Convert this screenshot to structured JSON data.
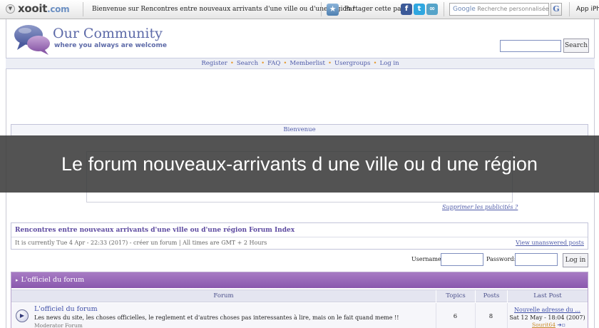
{
  "toolbar": {
    "logo_main": "xooit",
    "logo_ext": ".com",
    "welcome": "Bienvenue sur Rencontres entre nouveaux arrivants d'une ville ou d'une région !",
    "share_label": "Partager cette page",
    "social": [
      {
        "name": "facebook",
        "glyph": "f",
        "color": "#3b5998"
      },
      {
        "name": "twitter",
        "glyph": "t",
        "color": "#2fa7e0"
      },
      {
        "name": "share",
        "glyph": "∞",
        "color": "#56a4c9"
      }
    ],
    "search_brand": "Google",
    "search_placeholder": "Recherche personnalisée",
    "search_go": "G",
    "app_label": "App iPh"
  },
  "header": {
    "title": "Our Community",
    "subtitle": "where you always are welcome",
    "search_button": "Search"
  },
  "nav": {
    "items": [
      "Register",
      "Search",
      "FAQ",
      "Memberlist",
      "Usergroups",
      "Log in"
    ]
  },
  "welcome_bar": "Bienvenue",
  "ads": {
    "remove_link": "Supprimer les publicités ?"
  },
  "index": {
    "title": "Rencontres entre nouveaux arrivants d'une ville ou d'une région Forum Index",
    "time": "It is currently Tue 4 Apr - 22:33 (2017) - créer un forum | All times are GMT + 2 Hours",
    "unanswered": "View unanswered posts"
  },
  "login": {
    "username_label": "Username:",
    "password_label": "Password:",
    "button": "Log in"
  },
  "category": {
    "arrow": "▸",
    "title": "L'officiel du forum",
    "columns": {
      "forum": "Forum",
      "topics": "Topics",
      "posts": "Posts",
      "last_post": "Last Post"
    },
    "forums": [
      {
        "icon": "▶",
        "title": "L'officiel du forum",
        "description": "Les news du site, les choses officielles, le reglement et d'autres choses pas interessantes à lire, mais on le fait quand meme !!",
        "moderator": "Moderator Forum",
        "topics": "6",
        "posts": "8",
        "last_post_title": "Nouvelle adresse du ...",
        "last_post_date": "Sat 12 May - 18:04 (2007)",
        "last_post_user": "Sourit64"
      }
    ]
  },
  "banner": "Le forum nouveaux-arrivants d une ville ou d une région"
}
